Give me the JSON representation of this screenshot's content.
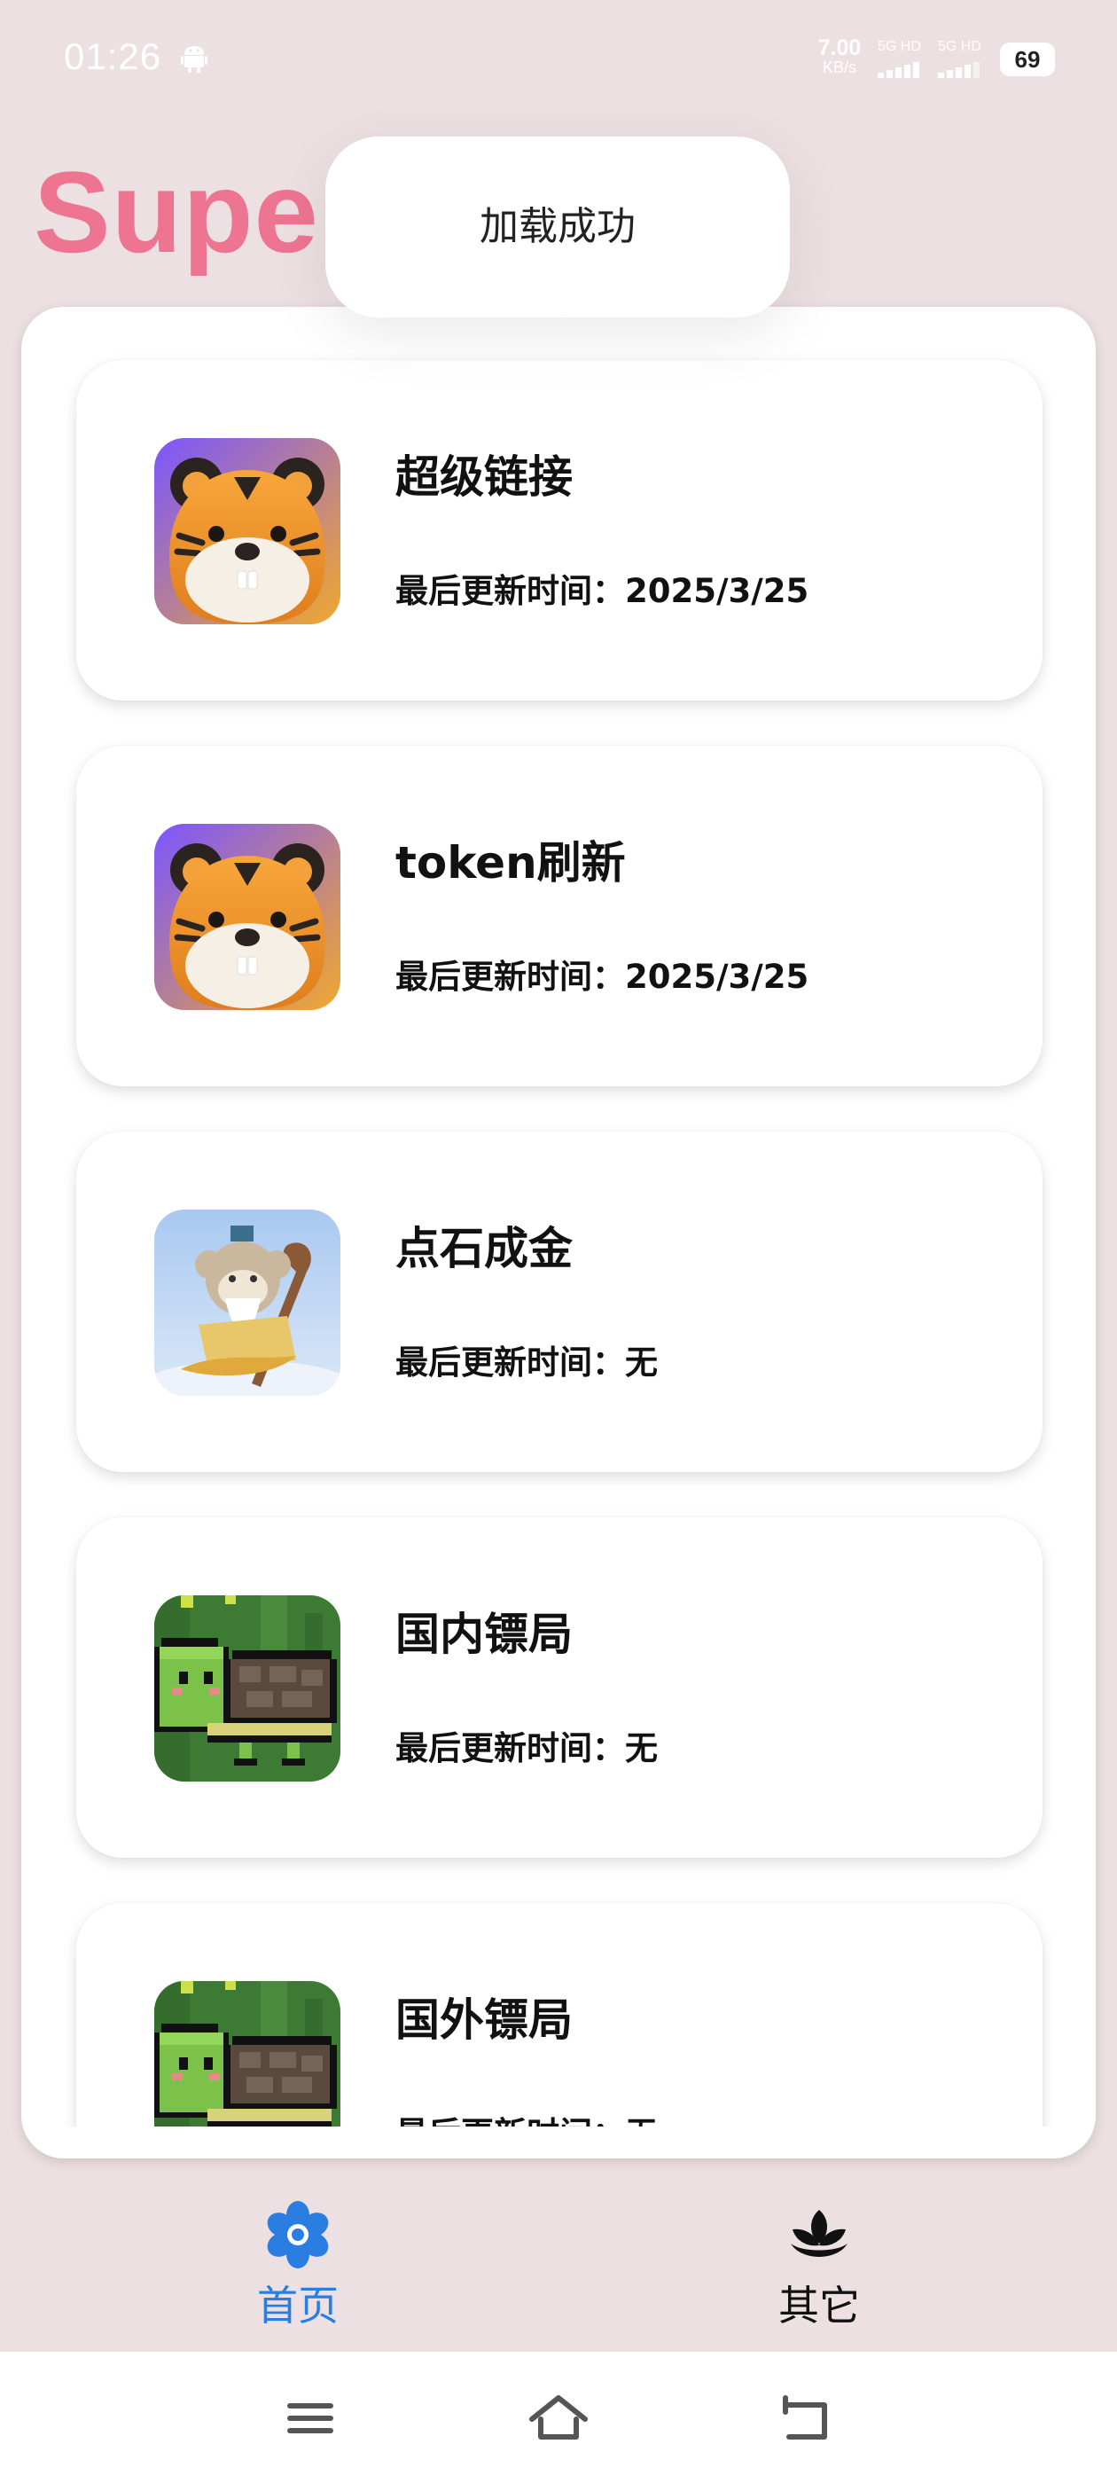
{
  "status_bar": {
    "time": "01:26",
    "net_speed_value": "7.00",
    "net_speed_unit": "KB/s",
    "signal_1_label": "5G HD",
    "signal_2_label": "5G HD",
    "battery": "69"
  },
  "app": {
    "title": "Super"
  },
  "toast": {
    "message": "加载成功"
  },
  "items": [
    {
      "title": "超级链接",
      "subtitle": "最后更新时间：2025/3/25",
      "icon": "tiger-icon"
    },
    {
      "title": "token刷新",
      "subtitle": "最后更新时间：2025/3/25",
      "icon": "tiger-icon"
    },
    {
      "title": "点石成金",
      "subtitle": "最后更新时间：无",
      "icon": "monkey-sage-icon"
    },
    {
      "title": "国内镖局",
      "subtitle": "最后更新时间：无",
      "icon": "pixel-turtle-icon"
    },
    {
      "title": "国外镖局",
      "subtitle": "最后更新时间：无",
      "icon": "pixel-turtle-icon"
    }
  ],
  "bottom_nav": {
    "home_label": "首页",
    "other_label": "其它",
    "home_icon": "flower-icon",
    "other_icon": "lotus-icon",
    "active": "home"
  },
  "colors": {
    "background": "#ede0e3",
    "title": "#ee7592",
    "active_tab": "#2a7de1"
  }
}
